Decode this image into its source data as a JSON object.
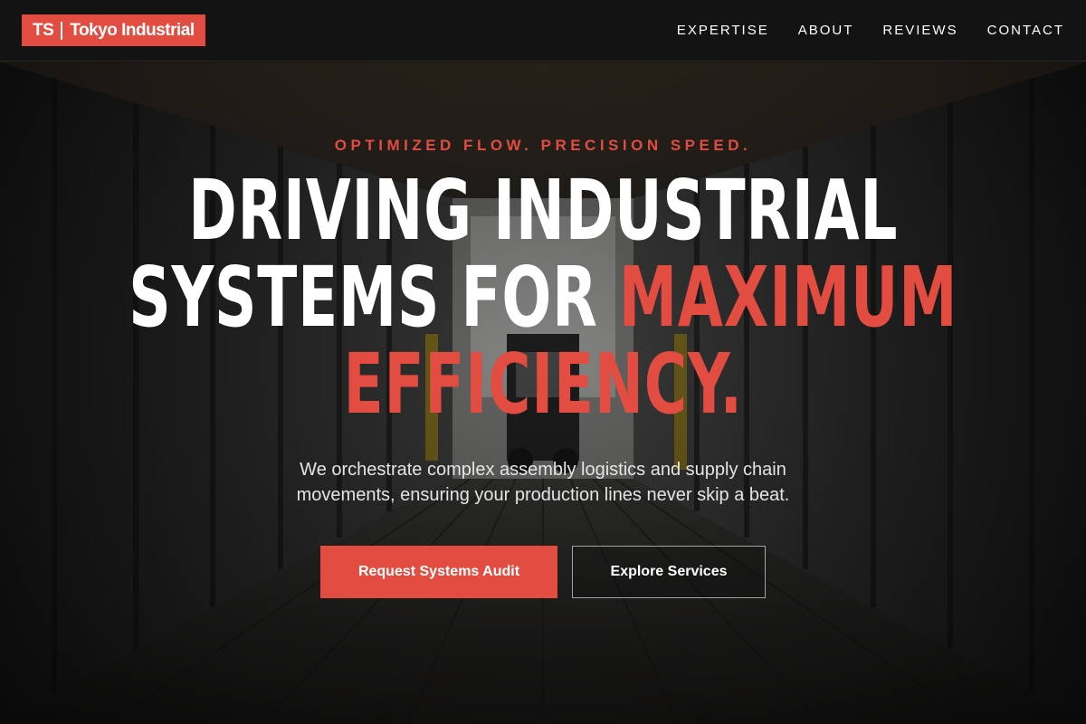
{
  "brand": {
    "initials": "TS",
    "name": "Tokyo Industrial",
    "accent_color": "#e34c40"
  },
  "nav": {
    "items": [
      {
        "label": "EXPERTISE"
      },
      {
        "label": "ABOUT"
      },
      {
        "label": "REVIEWS"
      },
      {
        "label": "CONTACT"
      }
    ]
  },
  "hero": {
    "eyebrow": "OPTIMIZED FLOW. PRECISION SPEED.",
    "headline_line1": "DRIVING INDUSTRIAL",
    "headline_line2_white": "SYSTEMS FOR ",
    "headline_line2_red": "MAXIMUM",
    "headline_line3_red": "EFFICIENCY.",
    "subtitle": "We orchestrate complex assembly logistics and supply chain movements, ensuring your production lines never skip a beat.",
    "primary_cta": "Request Systems Audit",
    "secondary_cta": "Explore Services"
  }
}
